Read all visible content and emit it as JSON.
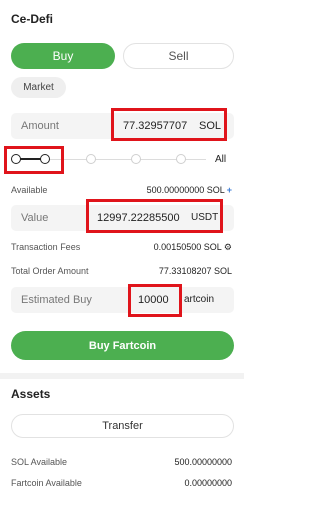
{
  "header": {
    "title": "Ce-Defi"
  },
  "order_side": {
    "buy_label": "Buy",
    "sell_label": "Sell",
    "selected": "Buy"
  },
  "order_type": {
    "label": "Market"
  },
  "amount": {
    "label": "Amount",
    "value": "77.32957707",
    "unit": "SOL"
  },
  "slider": {
    "all_label": "All",
    "level_percent": 0
  },
  "available": {
    "label": "Available",
    "value": "500.00000000 SOL",
    "plus": "+"
  },
  "value_field": {
    "label": "Value",
    "value": "12997.22285500",
    "unit": "USDT"
  },
  "fees": {
    "label": "Transaction Fees",
    "value": "0.00150500 SOL",
    "icon": "gear-icon"
  },
  "total": {
    "label": "Total Order Amount",
    "value": "77.33108207 SOL"
  },
  "estimated_buy": {
    "label": "Estimated Buy",
    "value": "10000",
    "unit": "artcoin"
  },
  "buy_button": {
    "label": "Buy Fartcoin"
  },
  "assets": {
    "title": "Assets",
    "transfer_label": "Transfer",
    "rows": [
      {
        "label": "SOL Available",
        "value": "500.00000000"
      },
      {
        "label": "Fartcoin Available",
        "value": "0.00000000"
      }
    ]
  },
  "colors": {
    "accent": "#4caf50",
    "highlight": "#e0141b",
    "link": "#3a7bd5"
  }
}
